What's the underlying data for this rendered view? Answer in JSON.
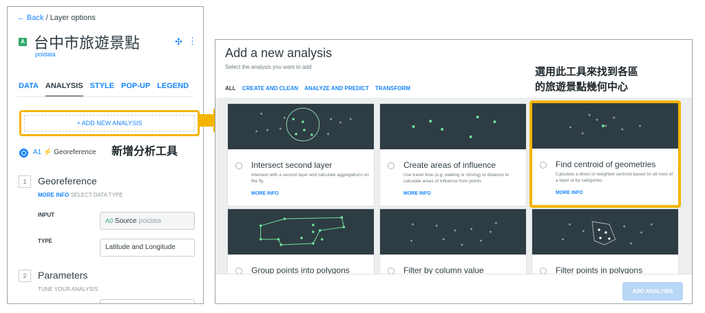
{
  "left_panel": {
    "back_label": "← Back",
    "breadcrumb_sep": " / ",
    "breadcrumb_current": "Layer options",
    "layer_badge": "A",
    "layer_name": "台中市旅遊景點",
    "layer_source": "poidata",
    "tabs": [
      "DATA",
      "ANALYSIS",
      "STYLE",
      "POP-UP",
      "LEGEND"
    ],
    "active_tab": "ANALYSIS",
    "add_analysis_label": "+ ADD NEW ANALYSIS",
    "analysis_item_code": "A1",
    "analysis_item_label": "Georeference",
    "step1_num": "1",
    "step1_title": "Georeference",
    "step1_more": "MORE INFO",
    "step1_sub": " SELECT DATA TYPE",
    "input_label": "INPUT",
    "input_code": "A0",
    "input_source": "Source",
    "input_placeholder": "poidata",
    "type_label": "TYPE",
    "type_value": "Latitude and Longitude",
    "step2_num": "2",
    "step2_title": "Parameters",
    "step2_sub": "TUNE YOUR ANALYSIS"
  },
  "annotations": {
    "add_tool": "新增分析工具",
    "centroid_line1": "選用此工具來找到各區",
    "centroid_line2": "的旅遊景點幾何中心"
  },
  "modal": {
    "title": "Add a new analysis",
    "subtitle": "Select the analysis you want to add",
    "tabs": [
      "ALL",
      "CREATE AND CLEAN",
      "ANALYZE AND PREDICT",
      "TRANSFORM"
    ],
    "active_tab": "ALL",
    "cards": [
      {
        "title": "Intersect second layer",
        "desc": "Intersect with a second layer and calculate aggregations on the fly.",
        "more": "MORE INFO"
      },
      {
        "title": "Create areas of influence",
        "desc": "Use travel time (e.g. walking or driving) or distance to calculate areas of influence from points.",
        "more": "MORE INFO"
      },
      {
        "title": "Find centroid of geometries",
        "desc": "Calculate a direct or weighted centroid based on all rows of a layer or by categories.",
        "more": "MORE INFO"
      },
      {
        "title": "Group points into polygons"
      },
      {
        "title": "Filter by column value"
      },
      {
        "title": "Filter points in polygons"
      }
    ],
    "add_button": "ADD ANALYSIS"
  },
  "colors": {
    "accent": "#1785fb",
    "highlight": "#f5b400",
    "thumb_bg": "#2e3c43",
    "point_green": "#6fe39b"
  }
}
